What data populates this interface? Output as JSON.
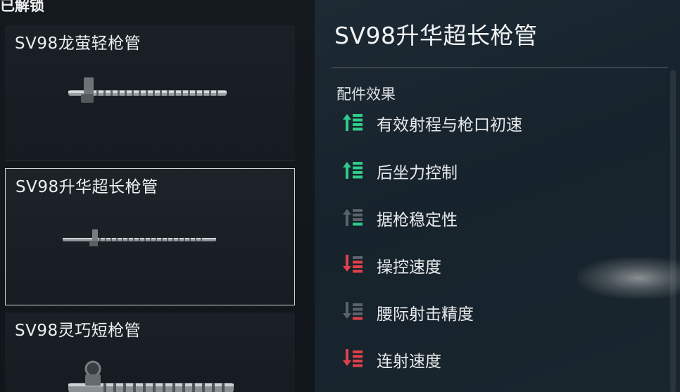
{
  "left_panel": {
    "section_title": "已解锁",
    "items": [
      {
        "name": "SV98龙萤轻枪管",
        "selected": false
      },
      {
        "name": "SV98升华超长枪管",
        "selected": true
      },
      {
        "name": "SV98灵巧短枪管",
        "selected": false
      }
    ]
  },
  "detail": {
    "title": "SV98升华超长枪管",
    "effects_label": "配件效果",
    "effects": [
      {
        "label": "有效射程与枪口初速",
        "direction": "up",
        "strength": "high",
        "color": "#2ecc8a"
      },
      {
        "label": "后坐力控制",
        "direction": "up",
        "strength": "high",
        "color": "#2ecc8a"
      },
      {
        "label": "据枪稳定性",
        "direction": "up",
        "strength": "low",
        "color": "#2ecc8a"
      },
      {
        "label": "操控速度",
        "direction": "down",
        "strength": "medium",
        "color": "#e0404a"
      },
      {
        "label": "腰际射击精度",
        "direction": "down",
        "strength": "low",
        "color": "#e0404a"
      },
      {
        "label": "连射速度",
        "direction": "down",
        "strength": "high",
        "color": "#e0404a"
      }
    ]
  },
  "colors": {
    "positive": "#2ecc8a",
    "negative": "#e0404a",
    "selection_border": "#d7d7d7"
  }
}
